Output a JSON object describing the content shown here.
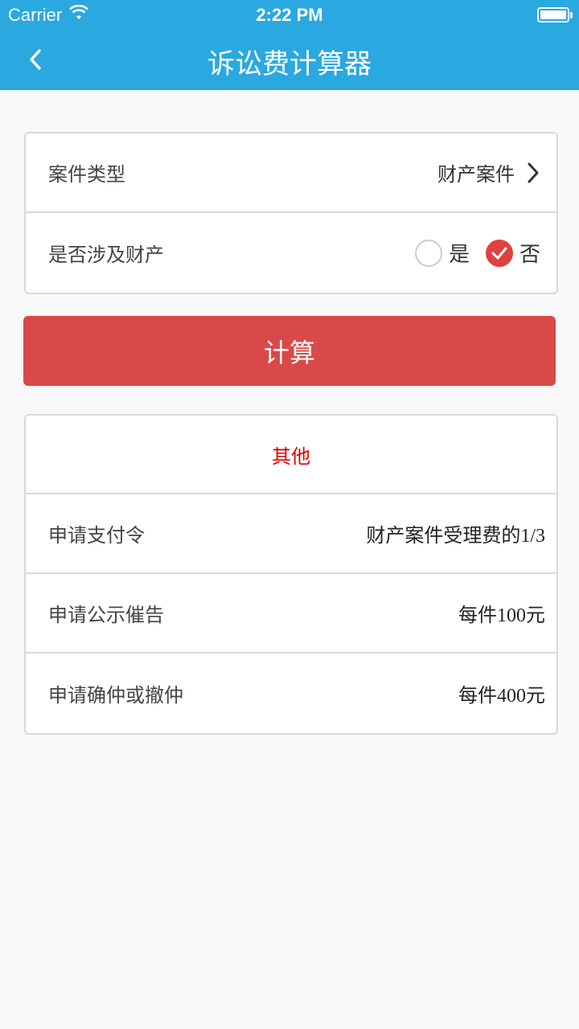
{
  "status_bar": {
    "carrier": "Carrier",
    "time": "2:22 PM"
  },
  "navbar": {
    "title": "诉讼费计算器"
  },
  "form": {
    "case_type": {
      "label": "案件类型",
      "value": "财产案件"
    },
    "involves_property": {
      "label": "是否涉及财产",
      "options": [
        {
          "label": "是",
          "checked": false
        },
        {
          "label": "否",
          "checked": true
        }
      ]
    }
  },
  "calculate_button": {
    "label": "计算"
  },
  "results": {
    "header": "其他",
    "rows": [
      {
        "label": "申请支付令",
        "value": "财产案件受理费的1/3"
      },
      {
        "label": "申请公示催告",
        "value": "每件100元"
      },
      {
        "label": "申请确仲或撤仲",
        "value": "每件400元"
      }
    ]
  },
  "colors": {
    "nav_bg": "#2aa8e0",
    "button_bg": "#da4949",
    "accent_red": "#e04040",
    "header_red": "#e00000"
  }
}
